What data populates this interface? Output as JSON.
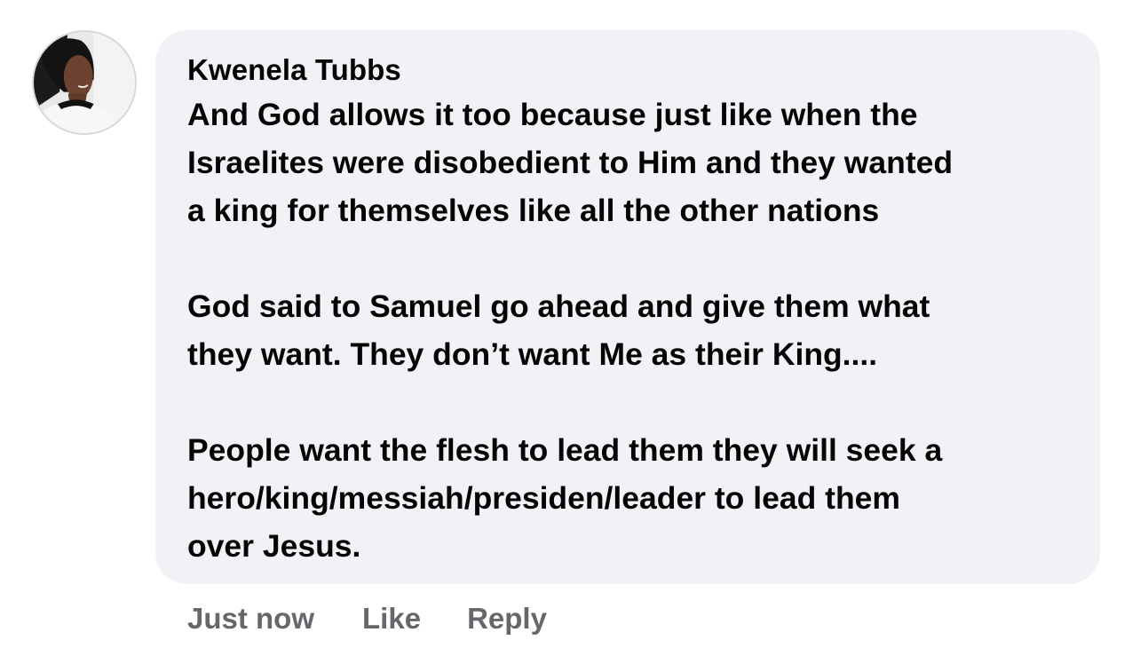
{
  "comment": {
    "author": "Kwenela Tubbs",
    "paragraphs": [
      {
        "lines": [
          "And God allows it too because just like when the",
          "Israelites were disobedient to Him and they wanted",
          "a king for themselves like all the other nations"
        ]
      },
      {
        "lines": [
          "God said to Samuel go ahead and give them what",
          "they want. They don’t want Me as their King...."
        ]
      },
      {
        "lines": [
          "People want the flesh to lead them they will seek a",
          "hero/king/messiah/presiden/leader to lead them",
          "over Jesus."
        ]
      }
    ]
  },
  "actions": {
    "timestamp": "Just now",
    "like_label": "Like",
    "reply_label": "Reply"
  },
  "colors": {
    "bubble_background": "#f0f2f5",
    "primary_text": "#050505",
    "secondary_text": "#65676b"
  }
}
